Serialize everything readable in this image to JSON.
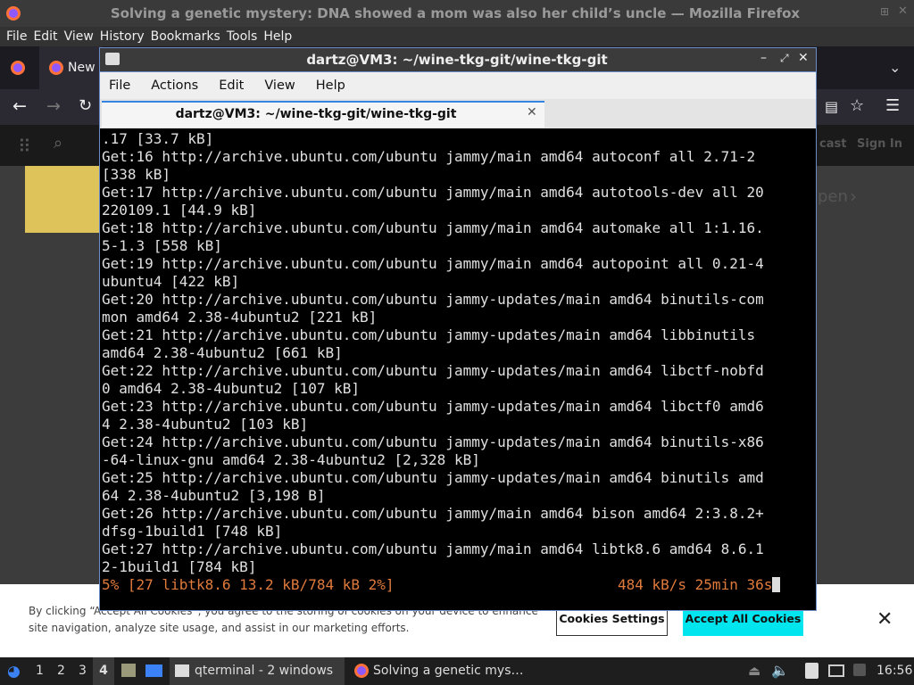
{
  "firefox": {
    "title": "Solving a genetic mystery: DNA showed a mom was also her child’s uncle — Mozilla Firefox",
    "menu": [
      "File",
      "Edit",
      "View",
      "History",
      "Bookmarks",
      "Tools",
      "Help"
    ],
    "tab_label": "New",
    "site_header_right": [
      "cast",
      "Sign In"
    ],
    "page_side_text": "pen",
    "cookie": {
      "text": "By clicking “Accept All Cookies”, you agree to the storing of cookies on your device to enhance site navigation, analyze site usage, and assist in our marketing efforts.",
      "settings_label": "Cookies Settings",
      "accept_label": "Accept All Cookies",
      "close_glyph": "✕"
    }
  },
  "terminal": {
    "title": "dartz@VM3: ~/wine-tkg-git/wine-tkg-git",
    "menu": [
      "File",
      "Actions",
      "Edit",
      "View",
      "Help"
    ],
    "tab_label": "dartz@VM3: ~/wine-tkg-git/wine-tkg-git",
    "lines": [
      ".17 [33.7 kB]",
      "Get:16 http://archive.ubuntu.com/ubuntu jammy/main amd64 autoconf all 2.71-2",
      "[338 kB]",
      "Get:17 http://archive.ubuntu.com/ubuntu jammy/main amd64 autotools-dev all 20",
      "220109.1 [44.9 kB]",
      "Get:18 http://archive.ubuntu.com/ubuntu jammy/main amd64 automake all 1:1.16.",
      "5-1.3 [558 kB]",
      "Get:19 http://archive.ubuntu.com/ubuntu jammy/main amd64 autopoint all 0.21-4",
      "ubuntu4 [422 kB]",
      "Get:20 http://archive.ubuntu.com/ubuntu jammy-updates/main amd64 binutils-com",
      "mon amd64 2.38-4ubuntu2 [221 kB]",
      "Get:21 http://archive.ubuntu.com/ubuntu jammy-updates/main amd64 libbinutils",
      "amd64 2.38-4ubuntu2 [661 kB]",
      "Get:22 http://archive.ubuntu.com/ubuntu jammy-updates/main amd64 libctf-nobfd",
      "0 amd64 2.38-4ubuntu2 [107 kB]",
      "Get:23 http://archive.ubuntu.com/ubuntu jammy-updates/main amd64 libctf0 amd6",
      "4 2.38-4ubuntu2 [103 kB]",
      "Get:24 http://archive.ubuntu.com/ubuntu jammy-updates/main amd64 binutils-x86",
      "-64-linux-gnu amd64 2.38-4ubuntu2 [2,328 kB]",
      "Get:25 http://archive.ubuntu.com/ubuntu jammy-updates/main amd64 binutils amd",
      "64 2.38-4ubuntu2 [3,198 B]",
      "Get:26 http://archive.ubuntu.com/ubuntu jammy/main amd64 bison amd64 2:3.8.2+",
      "dfsg-1build1 [748 kB]",
      "Get:27 http://archive.ubuntu.com/ubuntu jammy/main amd64 libtk8.6 amd64 8.6.1",
      "2-1build1 [784 kB]"
    ],
    "status_left": "5% [27 libtk8.6 13.2 kB/784 kB 2%]",
    "status_right": "484 kB/s 25min 36s"
  },
  "taskbar": {
    "workspaces": [
      "1",
      "2",
      "3",
      "4"
    ],
    "active_workspace": "4",
    "task_terminal": "qterminal - 2 windows",
    "task_firefox": "Solving a genetic mys…",
    "clock": "16:56"
  },
  "colors": {
    "terminal_bg": "#000000",
    "terminal_status": "#e07a3c",
    "cookie_accept": "#00e5ee",
    "window_border": "#6a8cc7"
  }
}
